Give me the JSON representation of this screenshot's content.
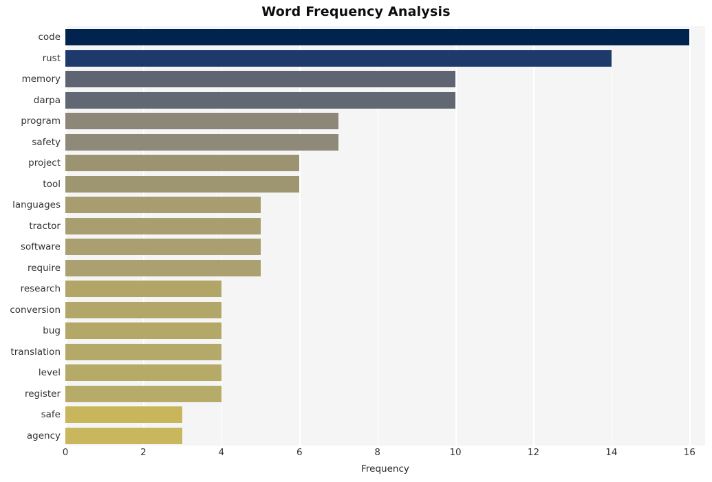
{
  "chart_data": {
    "type": "bar",
    "orientation": "horizontal",
    "title": "Word Frequency Analysis",
    "xlabel": "Frequency",
    "ylabel": "",
    "xlim": [
      0,
      16.4
    ],
    "ylim": [
      0,
      20
    ],
    "xticks": [
      0,
      2,
      4,
      6,
      8,
      10,
      12,
      14,
      16
    ],
    "xticklabels": [
      "0",
      "2",
      "4",
      "6",
      "8",
      "10",
      "12",
      "14",
      "16"
    ],
    "grid": "vertical-white-on-light-gray",
    "legend": "none",
    "categories": [
      "code",
      "rust",
      "memory",
      "darpa",
      "program",
      "safety",
      "project",
      "tool",
      "languages",
      "tractor",
      "software",
      "require",
      "research",
      "conversion",
      "bug",
      "translation",
      "level",
      "register",
      "safe",
      "agency"
    ],
    "values": [
      16,
      14,
      10,
      10,
      7,
      7,
      6,
      6,
      5,
      5,
      5,
      5,
      4,
      4,
      4,
      4,
      4,
      4,
      3,
      3
    ],
    "bar_colors": [
      "#00244e",
      "#1d3a6b",
      "#5f6472",
      "#626774",
      "#8c8779",
      "#8e8979",
      "#9c9470",
      "#9e9670",
      "#a79d70",
      "#a89e70",
      "#a99f70",
      "#aaa070",
      "#b1a668",
      "#b2a768",
      "#b3a868",
      "#b4a968",
      "#b5aa68",
      "#b6ab68",
      "#c7b65c",
      "#c8b75c"
    ],
    "plot_background": "#f5f5f6",
    "figure_background": "#ffffff",
    "gridline_color": "#ffffff",
    "tick_color": "#333333",
    "title_color": "#0d0d0d"
  }
}
